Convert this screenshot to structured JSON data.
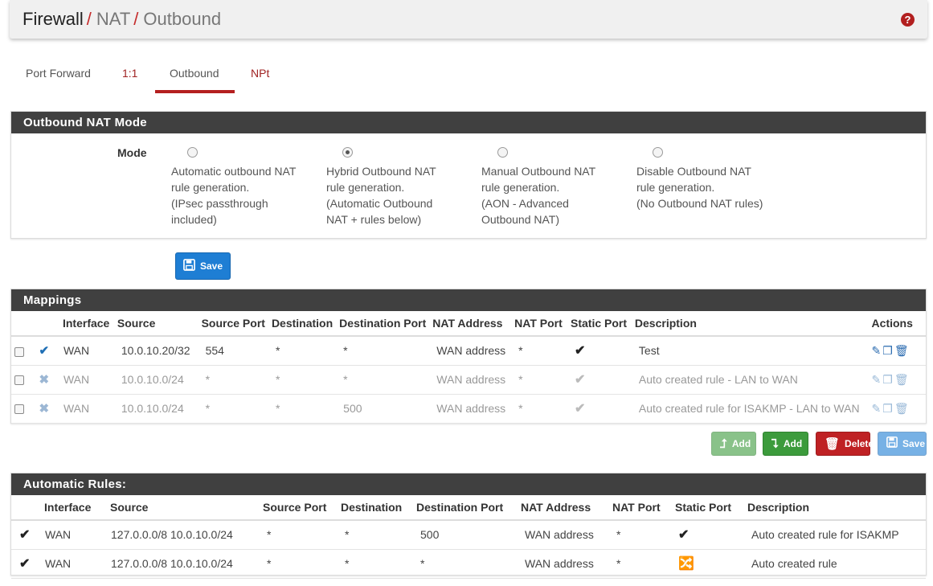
{
  "header": {
    "crumbs": [
      "Firewall",
      "NAT",
      "Outbound"
    ],
    "sep": "/",
    "help": "?"
  },
  "tabs": [
    {
      "label": "Port Forward"
    },
    {
      "label": "1:1"
    },
    {
      "label": "Outbound"
    },
    {
      "label": "NPt"
    }
  ],
  "mode_panel": {
    "title": "Outbound NAT Mode",
    "label": "Mode",
    "options": [
      {
        "lines": [
          "Automatic outbound NAT",
          "rule generation.",
          "(IPsec passthrough",
          "included)"
        ],
        "checked": false
      },
      {
        "lines": [
          "Hybrid Outbound NAT",
          "rule generation.",
          "(Automatic Outbound",
          "NAT + rules below)"
        ],
        "checked": true
      },
      {
        "lines": [
          "Manual Outbound NAT",
          "rule generation.",
          "(AON - Advanced",
          "Outbound NAT)"
        ],
        "checked": false
      },
      {
        "lines": [
          "Disable Outbound NAT",
          "rule generation.",
          "(No Outbound NAT rules)"
        ],
        "checked": false
      }
    ],
    "save_label": "Save"
  },
  "mappings": {
    "title": "Mappings",
    "headers": [
      "Interface",
      "Source",
      "Source Port",
      "Destination",
      "Destination Port",
      "NAT Address",
      "NAT Port",
      "Static Port",
      "Description",
      "Actions"
    ],
    "rows": [
      {
        "enabled": true,
        "interface": "WAN",
        "source": "10.0.10.20/32",
        "source_port": "554",
        "destination": "*",
        "dest_port": "*",
        "nat_address": "WAN address",
        "nat_port": "*",
        "description": "Test"
      },
      {
        "enabled": false,
        "interface": "WAN",
        "source": "10.0.10.0/24",
        "source_port": "*",
        "destination": "*",
        "dest_port": "*",
        "nat_address": "WAN address",
        "nat_port": "*",
        "description": "Auto created rule - LAN to WAN"
      },
      {
        "enabled": false,
        "interface": "WAN",
        "source": "10.0.10.0/24",
        "source_port": "*",
        "destination": "*",
        "dest_port": "500",
        "nat_address": "WAN address",
        "nat_port": "*",
        "description": "Auto created rule for ISAKMP - LAN to WAN"
      }
    ],
    "buttons": {
      "add_top": "Add",
      "add_bottom": "Add",
      "delete": "Delete",
      "save": "Save"
    }
  },
  "auto_rules": {
    "title": "Automatic Rules:",
    "headers": [
      "Interface",
      "Source",
      "Source Port",
      "Destination",
      "Destination Port",
      "NAT Address",
      "NAT Port",
      "Static Port",
      "Description"
    ],
    "rows": [
      {
        "interface": "WAN",
        "source": "127.0.0.0/8 10.0.10.0/24",
        "source_port": "*",
        "destination": "*",
        "dest_port": "500",
        "nat_address": "WAN address",
        "nat_port": "*",
        "static": "check",
        "description": "Auto created rule for ISAKMP"
      },
      {
        "interface": "WAN",
        "source": "127.0.0.0/8 10.0.10.0/24",
        "source_port": "*",
        "destination": "*",
        "dest_port": "*",
        "nat_address": "WAN address",
        "nat_port": "*",
        "static": "shuffle",
        "description": "Auto created rule"
      }
    ]
  },
  "colors": {
    "accent_red": "#b41f1f",
    "header_bg": "#404040",
    "btn_blue": "#1e7ed4",
    "btn_green": "#3c9b3c",
    "btn_red": "#bf2124"
  }
}
